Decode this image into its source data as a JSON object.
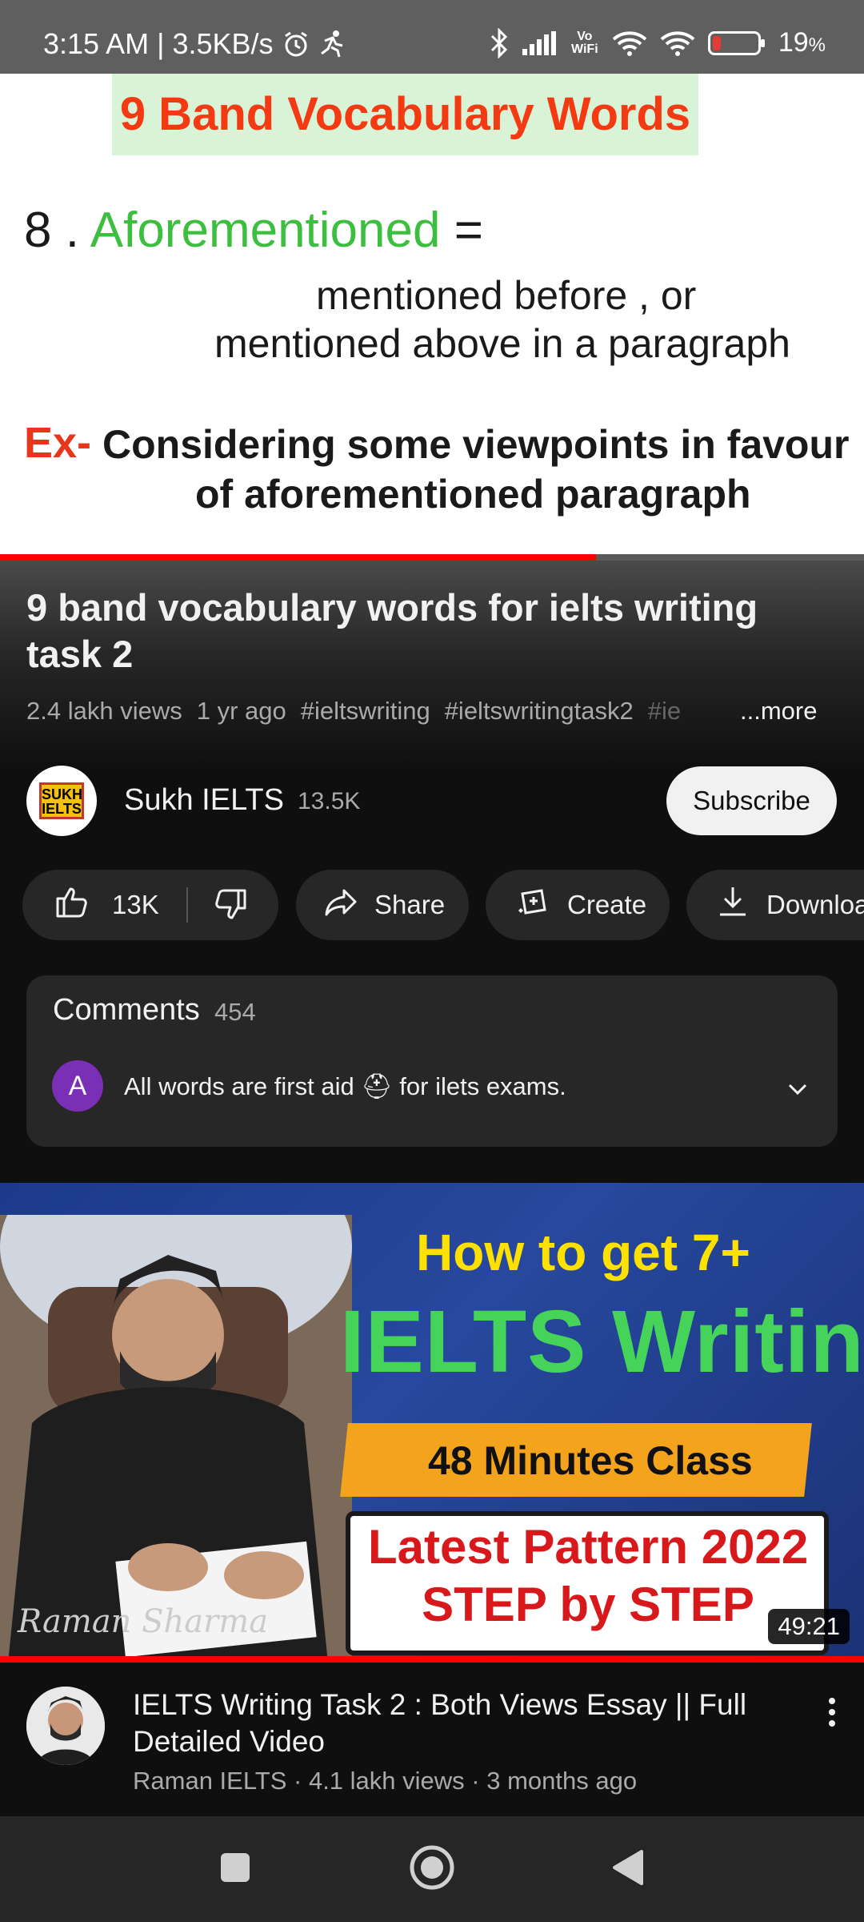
{
  "status_bar": {
    "time_speed": "3:15 AM | 3.5KB/s",
    "vowifi": "Vo WiFi",
    "battery_percent": "19",
    "battery_unit": "%",
    "battery_level": 0.19
  },
  "video": {
    "banner": "9 Band Vocabulary Words",
    "number": "8 . ",
    "word": "Aforementioned",
    "equals": " =",
    "definition_line1": "mentioned before , or",
    "definition_line2": "mentioned above in a paragraph",
    "example_label": "Ex-",
    "example_line1": "Considering some viewpoints in favour",
    "example_line2": "of aforementioned paragraph",
    "progress": 0.69
  },
  "info": {
    "title": "9 band vocabulary words for ielts writing task 2",
    "views": "2.4 lakh views",
    "age": "1 yr ago",
    "tags": [
      "#ieltswriting",
      "#ieltswritingtask2",
      "#ie"
    ],
    "more": "...more"
  },
  "channel": {
    "logo_text": "SUKH IELTS",
    "name": "Sukh IELTS",
    "subscribers": "13.5K",
    "subscribe_label": "Subscribe"
  },
  "actions": {
    "likes": "13K",
    "share": "Share",
    "create": "Create",
    "download": "Download"
  },
  "comments": {
    "label": "Comments",
    "count": "454",
    "avatar_letter": "A",
    "top_comment": "All words are first aid ⛑ for ilets exams."
  },
  "next_video": {
    "thumb_line1": "How to get 7+",
    "thumb_line2": "IELTS Writing",
    "thumb_band": "48 Minutes Class",
    "thumb_box1": "Latest Pattern 2022",
    "thumb_box2": "STEP by STEP",
    "signature": "Raman Sharma",
    "duration": "49:21",
    "title": "IELTS Writing Task 2 : Both Views Essay || Full Detailed Video",
    "channel": "Raman IELTS",
    "views": "4.1 lakh views",
    "age": "3 months ago"
  },
  "icons": {
    "alarm": "alarm-icon",
    "bluetooth": "bluetooth-icon",
    "signal": "signal-icon",
    "wifi": "wifi-icon",
    "like": "thumbs-up-icon",
    "dislike": "thumbs-down-icon",
    "share": "share-arrow-icon",
    "create": "create-sparkle-icon",
    "download": "download-icon",
    "expand": "chevron-down-icon",
    "menu": "more-vertical-icon",
    "recents": "square-icon",
    "home": "home-circle-icon",
    "back": "back-triangle-icon"
  },
  "colors": {
    "youtube_red": "#ff0000",
    "banner_red": "#f33a12",
    "word_green": "#3cbf3e",
    "avatar_purple": "#7b2fb7",
    "battery_red": "#e53935"
  }
}
